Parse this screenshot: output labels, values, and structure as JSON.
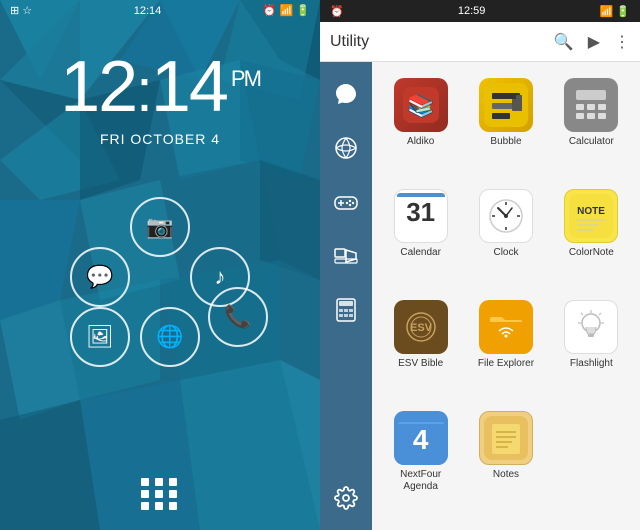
{
  "left": {
    "status_bar": {
      "left_icon": "⊞",
      "time": "12:14",
      "right_icons": [
        "alarm",
        "wifi",
        "signal",
        "battery"
      ]
    },
    "time": {
      "hours": "12",
      "colon": ":",
      "minutes": "14",
      "ampm": "PM"
    },
    "date": "FRI OCTOBER 4",
    "apps": [
      {
        "id": "camera",
        "icon": "📷",
        "label": "Camera"
      },
      {
        "id": "message",
        "icon": "💬",
        "label": "Message"
      },
      {
        "id": "music",
        "icon": "🎵",
        "label": "Music"
      },
      {
        "id": "gallery",
        "icon": "🖼",
        "label": "Gallery"
      },
      {
        "id": "globe",
        "icon": "🌐",
        "label": "Globe"
      },
      {
        "id": "phone",
        "icon": "📞",
        "label": "Phone"
      }
    ]
  },
  "right": {
    "status_bar": {
      "left_icons": "alarm",
      "time": "12:59",
      "right_icons": [
        "wifi",
        "signal",
        "battery"
      ]
    },
    "header": {
      "title": "Utility",
      "search_icon": "🔍",
      "play_icon": "▶",
      "menu_icon": "⋮"
    },
    "sidebar_items": [
      {
        "id": "chat",
        "icon": "💬"
      },
      {
        "id": "globe",
        "icon": "🌐"
      },
      {
        "id": "gamepad",
        "icon": "🎮"
      },
      {
        "id": "media",
        "icon": "🎵"
      },
      {
        "id": "calculator2",
        "icon": "🔢"
      },
      {
        "id": "settings",
        "icon": "⚙"
      }
    ],
    "apps": [
      {
        "id": "aldiko",
        "label": "Aldiko",
        "class": "icon-aldiko",
        "icon": "📚"
      },
      {
        "id": "bubble",
        "label": "Bubble",
        "class": "icon-bubble",
        "icon": "📐"
      },
      {
        "id": "calculator",
        "label": "Calculator",
        "class": "icon-calculator",
        "icon": "🧮"
      },
      {
        "id": "calendar",
        "label": "Calendar",
        "class": "icon-calendar",
        "icon": "cal",
        "cal_day": "31",
        "cal_month": ""
      },
      {
        "id": "clock",
        "label": "Clock",
        "class": "icon-clock",
        "icon": "clock"
      },
      {
        "id": "colornote",
        "label": "ColorNote",
        "class": "icon-colornote",
        "icon": "note"
      },
      {
        "id": "esvbible",
        "label": "ESV Bible",
        "class": "icon-esvbible",
        "icon": "📖"
      },
      {
        "id": "fileexplorer",
        "label": "File Explorer",
        "class": "icon-fileexplorer",
        "icon": "📁"
      },
      {
        "id": "flashlight",
        "label": "Flashlight",
        "class": "icon-flashlight",
        "icon": "flashlight"
      },
      {
        "id": "nextfour",
        "label": "NextFour\nAgenda",
        "class": "icon-nextfour",
        "icon": "cal4",
        "cal_day": "4"
      },
      {
        "id": "notes",
        "label": "Notes",
        "class": "icon-notes",
        "icon": "📝"
      }
    ]
  }
}
